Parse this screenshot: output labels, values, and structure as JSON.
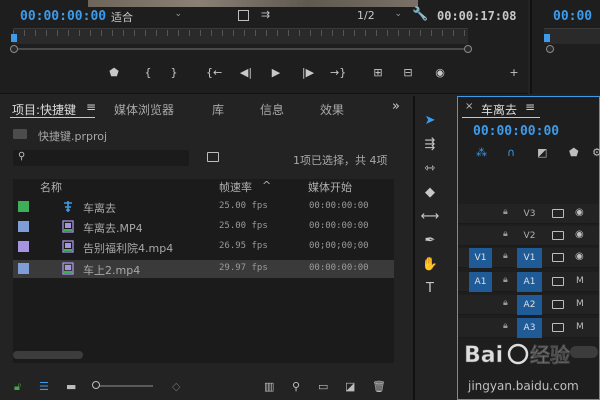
{
  "source_monitor": {
    "timecode": "00:00:00:00",
    "fit_value": "适合",
    "resolution_value": "1/2",
    "duration": "00:00:17:08",
    "transport_icons": [
      "marker-icon",
      "mark-in-icon",
      "mark-out-icon",
      "go-to-in-icon",
      "step-back-icon",
      "play-icon",
      "step-forward-icon",
      "go-to-out-icon",
      "insert-icon",
      "overwrite-icon",
      "export-frame-icon",
      "add-button-icon"
    ],
    "transport_glyphs": [
      "⬟",
      "{",
      "}",
      "{←",
      "◀|",
      "▶",
      "|▶",
      "→}",
      "⊞",
      "⊟",
      "◉",
      "+"
    ]
  },
  "program_monitor": {
    "timecode": "00:00"
  },
  "project_panel": {
    "tabs": [
      "项目:快捷键",
      "媒体浏览器",
      "库",
      "信息",
      "效果"
    ],
    "menu_glyph": "≡",
    "overflow_glyph": "»",
    "project_file": "快捷键.prproj",
    "selection_status": "1项已选择，共 4项",
    "columns": {
      "name": "名称",
      "frame_rate": "帧速率",
      "sort_indicator": "^",
      "media_start": "媒体开始"
    },
    "rows": [
      {
        "name": "车离去",
        "fps": "25.00 fps",
        "start": "00:00:00:00",
        "color": "#3fae5a",
        "icon": "sequence-icon"
      },
      {
        "name": "车离去.MP4",
        "fps": "25.00 fps",
        "start": "00:00:00:00",
        "color": "#7f9ed8",
        "icon": "video-clip-icon"
      },
      {
        "name": "告别福利院4.mp4",
        "fps": "26.95 fps",
        "start": "00;00;00;00",
        "color": "#a694e0",
        "icon": "video-clip-icon"
      },
      {
        "name": "车上2.mp4",
        "fps": "29.97 fps",
        "start": "00:00:00:00",
        "color": "#7f9ed8",
        "icon": "video-clip-icon"
      }
    ]
  },
  "timeline": {
    "close_glyph": "×",
    "title": "车离去",
    "timecode": "00:00:00:00",
    "tracks": [
      {
        "source": "",
        "name": "V3",
        "type": "video",
        "enabled": false
      },
      {
        "source": "",
        "name": "V2",
        "type": "video",
        "enabled": false
      },
      {
        "source": "V1",
        "name": "V1",
        "type": "video",
        "enabled": true
      },
      {
        "source": "A1",
        "name": "A1",
        "type": "audio",
        "enabled": true
      },
      {
        "source": "",
        "name": "A2",
        "type": "audio",
        "enabled": true
      },
      {
        "source": "",
        "name": "A3",
        "type": "audio",
        "enabled": true
      }
    ],
    "mute_label": "M"
  },
  "colors": {
    "accent": "#3d9bea",
    "track_selected": "#1f5b97",
    "background": "#232323"
  },
  "watermark": {
    "text": "Baidu经验",
    "url": "jingyan.baidu.com"
  }
}
